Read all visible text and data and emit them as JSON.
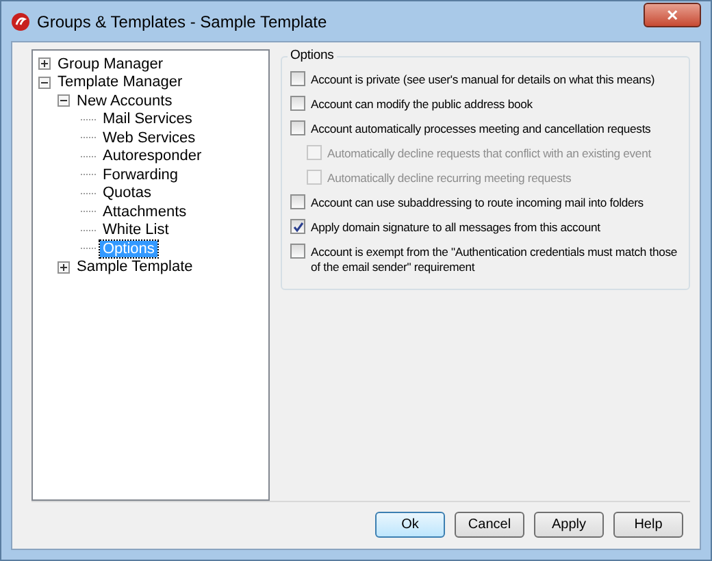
{
  "window": {
    "title": "Groups & Templates - Sample Template",
    "close": "✕"
  },
  "tree": [
    {
      "label": "Group Manager",
      "expanded": false,
      "selected": false
    },
    {
      "label": "Template Manager",
      "expanded": true,
      "selected": false,
      "children": [
        {
          "label": "New Accounts",
          "expanded": true,
          "selected": false,
          "children": [
            {
              "label": "Mail Services",
              "selected": false
            },
            {
              "label": "Web Services",
              "selected": false
            },
            {
              "label": "Autoresponder",
              "selected": false
            },
            {
              "label": "Forwarding",
              "selected": false
            },
            {
              "label": "Quotas",
              "selected": false
            },
            {
              "label": "Attachments",
              "selected": false
            },
            {
              "label": "White List",
              "selected": false
            },
            {
              "label": "Options",
              "selected": true
            }
          ]
        },
        {
          "label": "Sample Template",
          "expanded": false,
          "selected": false
        }
      ]
    }
  ],
  "options": {
    "title": "Options",
    "items": [
      {
        "label": "Account is private (see user's manual for details on what this means)",
        "checked": false,
        "disabled": false
      },
      {
        "label": "Account can modify the public address book",
        "checked": false,
        "disabled": false
      },
      {
        "label": "Account automatically processes meeting and cancellation requests",
        "checked": false,
        "disabled": false,
        "children": [
          {
            "label": "Automatically decline requests that conflict with an existing event",
            "checked": false,
            "disabled": true
          },
          {
            "label": "Automatically decline recurring meeting requests",
            "checked": false,
            "disabled": true
          }
        ]
      },
      {
        "label": "Account can use subaddressing to route incoming mail into folders",
        "checked": false,
        "disabled": false
      },
      {
        "label": "Apply domain signature to all messages from this account",
        "checked": true,
        "disabled": false
      },
      {
        "label": "Account is exempt from the \"Authentication credentials must match those of the email sender\" requirement",
        "checked": false,
        "disabled": false
      }
    ]
  },
  "buttons": [
    {
      "label": "Ok",
      "default": true
    },
    {
      "label": "Cancel",
      "default": false
    },
    {
      "label": "Apply",
      "default": false
    },
    {
      "label": "Help",
      "default": false
    }
  ]
}
